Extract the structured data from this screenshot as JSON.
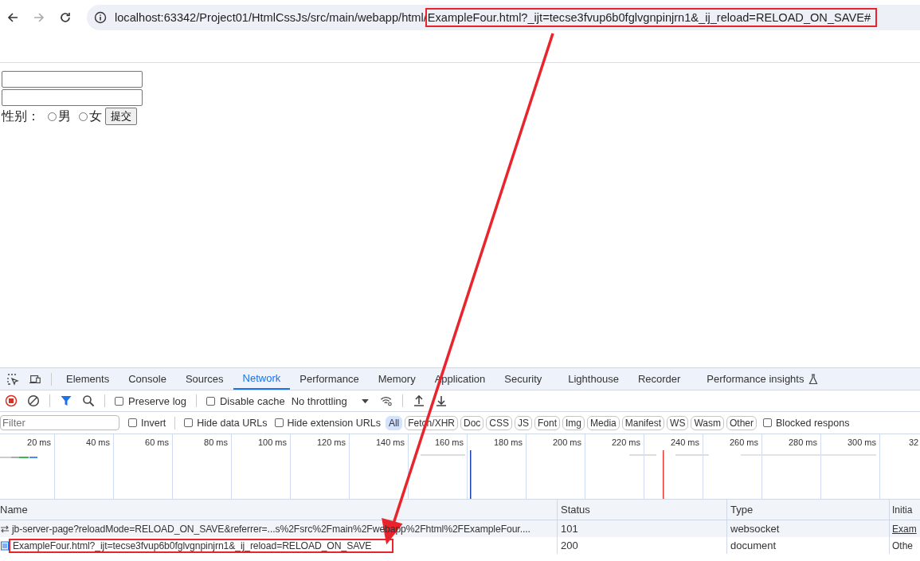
{
  "address_bar": {
    "url": "localhost:63342/Project01/HtmlCssJs/src/main/webapp/html/",
    "url_highlighted": "ExampleFour.html?_ijt=tecse3fvup6b0fglvgnpinjrn1&_ij_reload=RELOAD_ON_SAVE#"
  },
  "form": {
    "inputs": [
      {
        "kind": "text"
      },
      {
        "kind": "text"
      }
    ],
    "gender_label": "性别：",
    "radios": [
      {
        "label": "男",
        "selected": false
      },
      {
        "label": "女",
        "selected": false
      }
    ],
    "submit": "提交"
  },
  "devtools": {
    "tabs": [
      {
        "label": "Elements",
        "selected": false
      },
      {
        "label": "Console",
        "selected": false
      },
      {
        "label": "Sources",
        "selected": false
      },
      {
        "label": "Network",
        "selected": true
      },
      {
        "label": "Performance",
        "selected": false
      },
      {
        "label": "Memory",
        "selected": false
      },
      {
        "label": "Application",
        "selected": false
      },
      {
        "label": "Security",
        "selected": false
      },
      {
        "label": "Lighthouse",
        "selected": false
      },
      {
        "label": "Recorder",
        "selected": false
      },
      {
        "label": "Performance insights",
        "selected": false
      }
    ],
    "toolbar": {
      "preserve_log": {
        "label": "Preserve log",
        "checked": false
      },
      "disable_cache": {
        "label": "Disable cache",
        "checked": false
      },
      "throttling": "No throttling"
    },
    "filter": {
      "placeholder": "Filter",
      "invert": {
        "label": "Invert",
        "checked": false
      },
      "hide_data_urls": {
        "label": "Hide data URLs",
        "checked": false
      },
      "hide_extension_urls": {
        "label": "Hide extension URLs",
        "checked": false
      },
      "types": [
        {
          "label": "All",
          "selected": true
        },
        {
          "label": "Fetch/XHR",
          "selected": false
        },
        {
          "label": "Doc",
          "selected": false
        },
        {
          "label": "CSS",
          "selected": false
        },
        {
          "label": "JS",
          "selected": false
        },
        {
          "label": "Font",
          "selected": false
        },
        {
          "label": "Img",
          "selected": false
        },
        {
          "label": "Media",
          "selected": false
        },
        {
          "label": "Manifest",
          "selected": false
        },
        {
          "label": "WS",
          "selected": false
        },
        {
          "label": "Wasm",
          "selected": false
        },
        {
          "label": "Other",
          "selected": false
        }
      ],
      "blocked": {
        "label": "Blocked respons",
        "checked": false
      }
    },
    "timeline": {
      "ticks": [
        "20 ms",
        "40 ms",
        "60 ms",
        "80 ms",
        "100 ms",
        "120 ms",
        "140 ms",
        "160 ms",
        "180 ms",
        "200 ms",
        "220 ms",
        "240 ms",
        "260 ms",
        "280 ms",
        "300 ms",
        "32"
      ]
    },
    "table": {
      "columns": [
        "Name",
        "Status",
        "Type",
        "Initia"
      ],
      "rows": [
        {
          "kind": "websocket",
          "name": "jb-server-page?reloadMode=RELOAD_ON_SAVE&referrer=...s%2Fsrc%2Fmain%2Fwebapp%2Fhtml%2FExampleFour....",
          "status": "101",
          "type": "websocket",
          "initiator": "Exam",
          "annotated": false
        },
        {
          "kind": "document",
          "name": "ExampleFour.html?_ijt=tecse3fvup6b0fglvgnpinjrn1&_ij_reload=RELOAD_ON_SAVE",
          "status": "200",
          "type": "document",
          "initiator": "Othe",
          "annotated": true
        }
      ]
    }
  }
}
